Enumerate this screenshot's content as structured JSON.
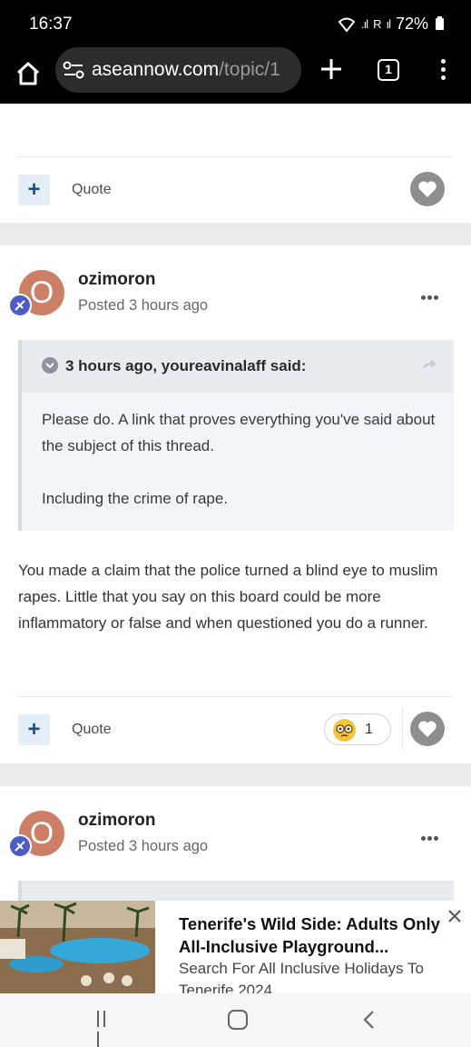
{
  "status_bar": {
    "time": "16:37",
    "signal": "R",
    "battery": "72%"
  },
  "browser": {
    "url_domain": "aseannow.com",
    "url_path": "/topic/1",
    "tab_count": "1"
  },
  "card1": {
    "quote_label": "Quote"
  },
  "post1": {
    "username": "ozimoron",
    "avatar_letter": "O",
    "posted": "Posted 3 hours ago",
    "quote": {
      "citation": "3 hours ago, youreavinalaff said:",
      "line1": "Please do. A link that proves everything you've said about the subject of this thread.",
      "line2": "Including the crime of rape."
    },
    "body": "You made a claim that the police turned a blind eye to muslim rapes. Little that you say on this board could be more inflammatory or false and when questioned you do a runner.",
    "quote_label": "Quote",
    "reaction_count": "1"
  },
  "post2": {
    "username": "ozimoron",
    "avatar_letter": "O",
    "posted": "Posted 3 hours ago"
  },
  "ad": {
    "title": "Tenerife's Wild Side: Adults Only All-Inclusive Playground...",
    "subtitle": "Search For All Inclusive Holidays To Tenerife 2024"
  },
  "colors": {
    "accent": "#1d4f7e",
    "avatar": "#cd7e66",
    "badge": "#4c5cc4"
  }
}
